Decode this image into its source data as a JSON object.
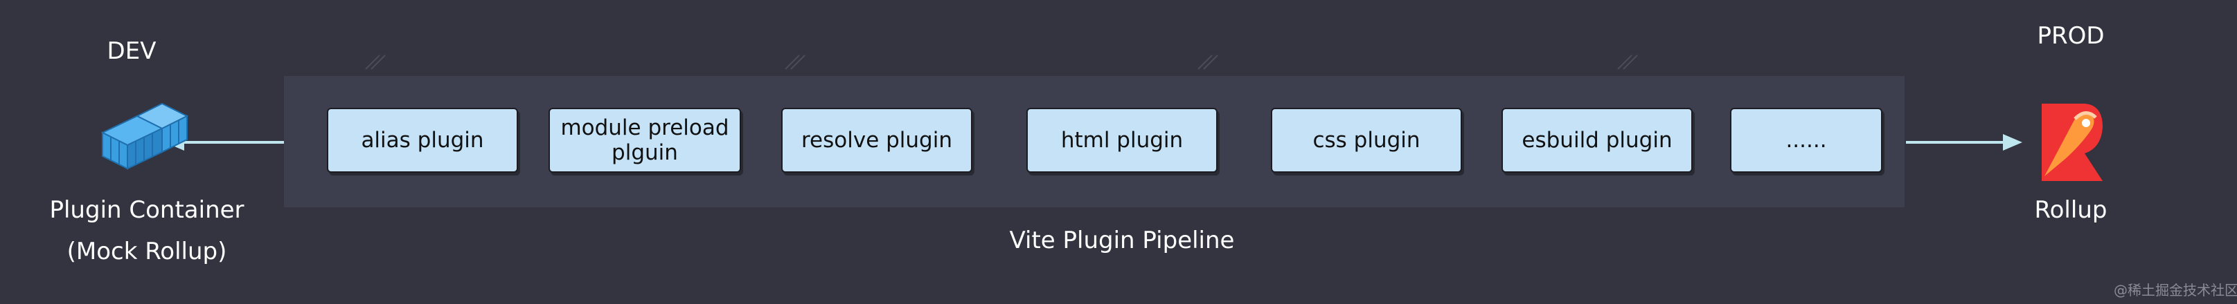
{
  "dev": {
    "title": "DEV",
    "container_name": "Plugin Container",
    "container_sub": "(Mock Rollup)"
  },
  "prod": {
    "title": "PROD",
    "tool_name": "Rollup"
  },
  "pipeline": {
    "caption": "Vite Plugin Pipeline",
    "plugins": [
      "alias plugin",
      "module preload\nplguin",
      "resolve plugin",
      "html plugin",
      "css plugin",
      "esbuild plugin",
      "......"
    ]
  },
  "watermark": "@稀土掘金技术社区",
  "colors": {
    "background": "#33343f",
    "pipeline_band": "#3d3f4f",
    "plugin_fill": "#c5e2f7",
    "arrow": "#bfe6ef",
    "container_icon": "#3a9fe0",
    "rollup_logo": "#ef3335"
  },
  "icons": {
    "plugin_container": "container-cube-icon",
    "rollup": "rollup-logo-icon"
  }
}
